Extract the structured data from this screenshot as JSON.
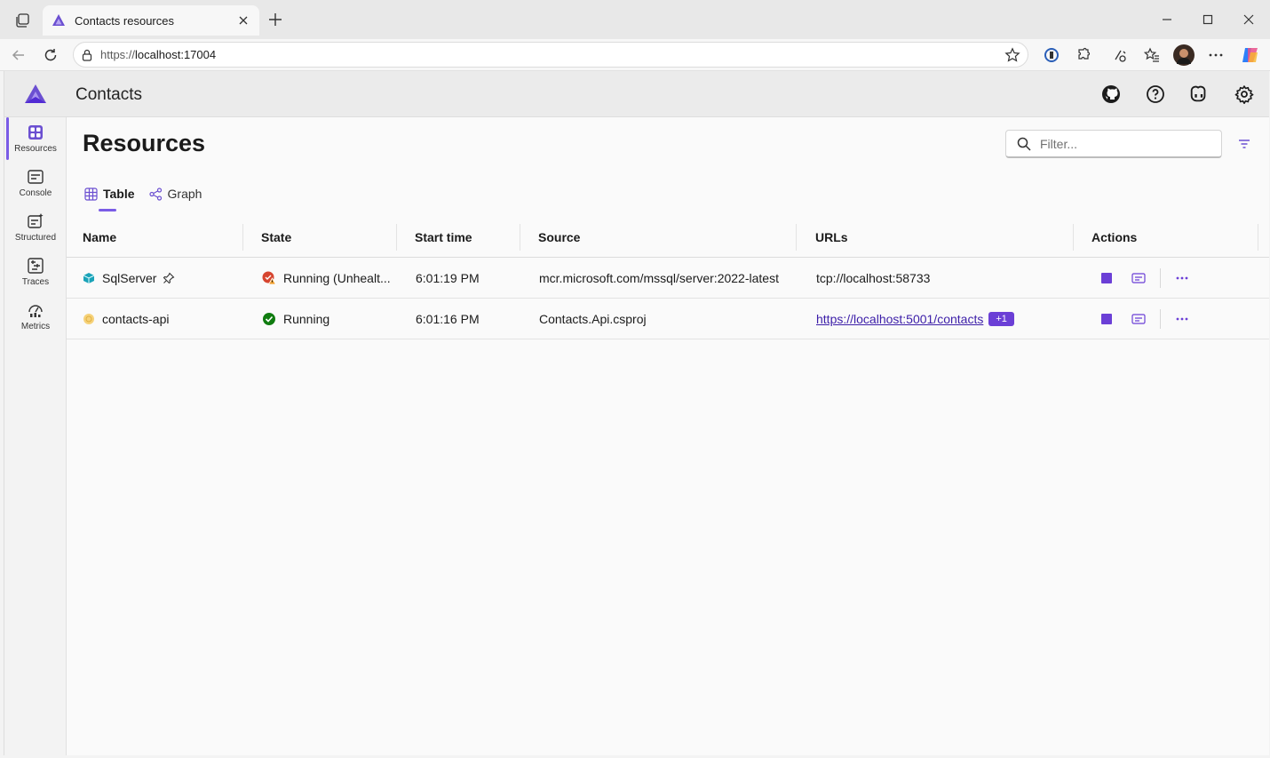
{
  "browser": {
    "tab_title": "Contacts resources",
    "url_prefix": "https://",
    "url_host": "localhost:17004"
  },
  "app": {
    "title": "Contacts",
    "accent": "#7a5ce6"
  },
  "sidebar": {
    "items": [
      {
        "label": "Resources",
        "icon": "resources-grid-icon"
      },
      {
        "label": "Console",
        "icon": "console-icon"
      },
      {
        "label": "Structured",
        "icon": "structured-logs-icon"
      },
      {
        "label": "Traces",
        "icon": "traces-icon"
      },
      {
        "label": "Metrics",
        "icon": "metrics-icon"
      }
    ]
  },
  "page": {
    "title": "Resources",
    "filter_placeholder": "Filter...",
    "tabs": [
      {
        "label": "Table"
      },
      {
        "label": "Graph"
      }
    ]
  },
  "table": {
    "columns": [
      "Name",
      "State",
      "Start time",
      "Source",
      "URLs",
      "Actions"
    ],
    "rows": [
      {
        "name": "SqlServer",
        "state": "Running (Unhealt...",
        "start_time": "6:01:19 PM",
        "source": "mcr.microsoft.com/mssql/server:2022-latest",
        "url": "tcp://localhost:58733",
        "extra_urls": ""
      },
      {
        "name": "contacts-api",
        "state": "Running",
        "start_time": "6:01:16 PM",
        "source": "Contacts.Api.csproj",
        "url": "https://localhost:5001/contacts",
        "extra_urls": "+1"
      }
    ]
  }
}
